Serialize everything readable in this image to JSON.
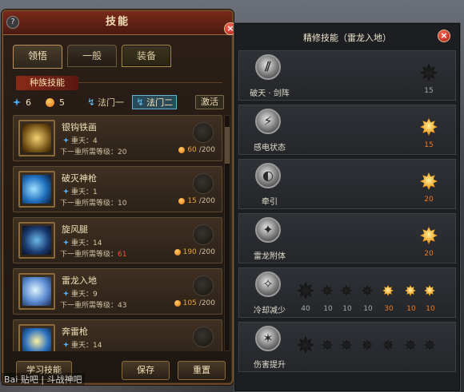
{
  "left_panel": {
    "title": "技能",
    "help_label": "?",
    "close_label": "×",
    "tabs": [
      {
        "label": "领悟"
      },
      {
        "label": "一般"
      },
      {
        "label": "装备"
      }
    ],
    "section_label": "种族技能",
    "blue_points": "6",
    "orange_points": "5",
    "rune_one": "法门一",
    "rune_two": "法门二",
    "activate_label": "激活",
    "skills": [
      {
        "name": "银钩铁画",
        "level": "重天：4",
        "req": "下一重所需等级：20",
        "req_red": "",
        "cost_cur": "60",
        "cost_max": "/200"
      },
      {
        "name": "破灭神枪",
        "level": "重天：1",
        "req": "下一重所需等级：10",
        "req_red": "",
        "cost_cur": "15",
        "cost_max": "/200"
      },
      {
        "name": "旋风腿",
        "level": "重天：14",
        "req": "下一重所需等级：",
        "req_red": "61",
        "cost_cur": "190",
        "cost_max": "/200"
      },
      {
        "name": "雷龙入地",
        "level": "重天：9",
        "req": "下一重所需等级：43",
        "req_red": "",
        "cost_cur": "105",
        "cost_max": "/200"
      },
      {
        "name": "奔雷枪",
        "level": "重天：14",
        "req": "",
        "req_red": "",
        "cost_cur": "",
        "cost_max": ""
      }
    ],
    "learn_label": "学习技能",
    "save_label": "保存",
    "reset_label": "重置",
    "watermark": "Bai 贴吧 | 斗战神吧"
  },
  "right_panel": {
    "title": "精修技能（雷龙入地）",
    "close_label": "×",
    "rows": [
      {
        "name": "破天 · 剑阵",
        "glyph": "⫽",
        "nodes": [
          {
            "value": "15",
            "lit": false
          }
        ]
      },
      {
        "name": "感电状态",
        "glyph": "⚡",
        "nodes": [
          {
            "value": "15",
            "lit": true
          }
        ]
      },
      {
        "name": "牵引",
        "glyph": "◐",
        "nodes": [
          {
            "value": "20",
            "lit": true
          }
        ]
      },
      {
        "name": "雷龙附体",
        "glyph": "✦",
        "nodes": [
          {
            "value": "20",
            "lit": true
          }
        ]
      },
      {
        "name": "冷却减少",
        "glyph": "✧",
        "nodes": [
          {
            "value": "40",
            "lit": false
          },
          {
            "value": "10",
            "lit": false
          },
          {
            "value": "10",
            "lit": false
          },
          {
            "value": "10",
            "lit": false
          },
          {
            "value": "30",
            "lit": true
          },
          {
            "value": "10",
            "lit": true
          },
          {
            "value": "10",
            "lit": true
          }
        ]
      },
      {
        "name": "伤害提升",
        "glyph": "✶",
        "nodes": [
          {
            "value": "",
            "lit": false
          },
          {
            "value": "",
            "lit": false
          },
          {
            "value": "",
            "lit": false
          },
          {
            "value": "",
            "lit": false
          },
          {
            "value": "",
            "lit": false
          },
          {
            "value": "",
            "lit": false
          },
          {
            "value": "",
            "lit": false
          }
        ]
      }
    ]
  }
}
